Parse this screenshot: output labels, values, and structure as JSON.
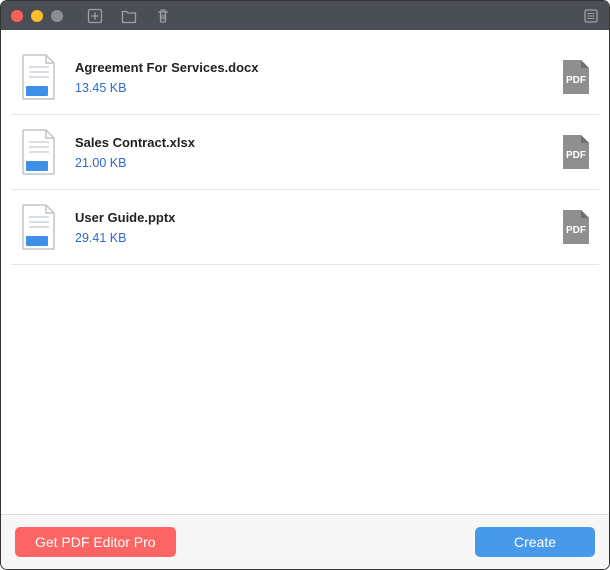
{
  "titlebar": {
    "icons": {
      "add": "add-file-icon",
      "folder": "folder-icon",
      "trash": "trash-icon",
      "list": "list-icon"
    }
  },
  "files": [
    {
      "name": "Agreement For Services.docx",
      "size": "13.45 KB",
      "badge": "PDF"
    },
    {
      "name": "Sales Contract.xlsx",
      "size": "21.00 KB",
      "badge": "PDF"
    },
    {
      "name": "User Guide.pptx",
      "size": "29.41 KB",
      "badge": "PDF"
    }
  ],
  "footer": {
    "pro_label": "Get PDF Editor Pro",
    "create_label": "Create"
  },
  "colors": {
    "accent_blue": "#4999e9",
    "accent_red": "#fd6464",
    "link_blue": "#2b6ad0"
  }
}
